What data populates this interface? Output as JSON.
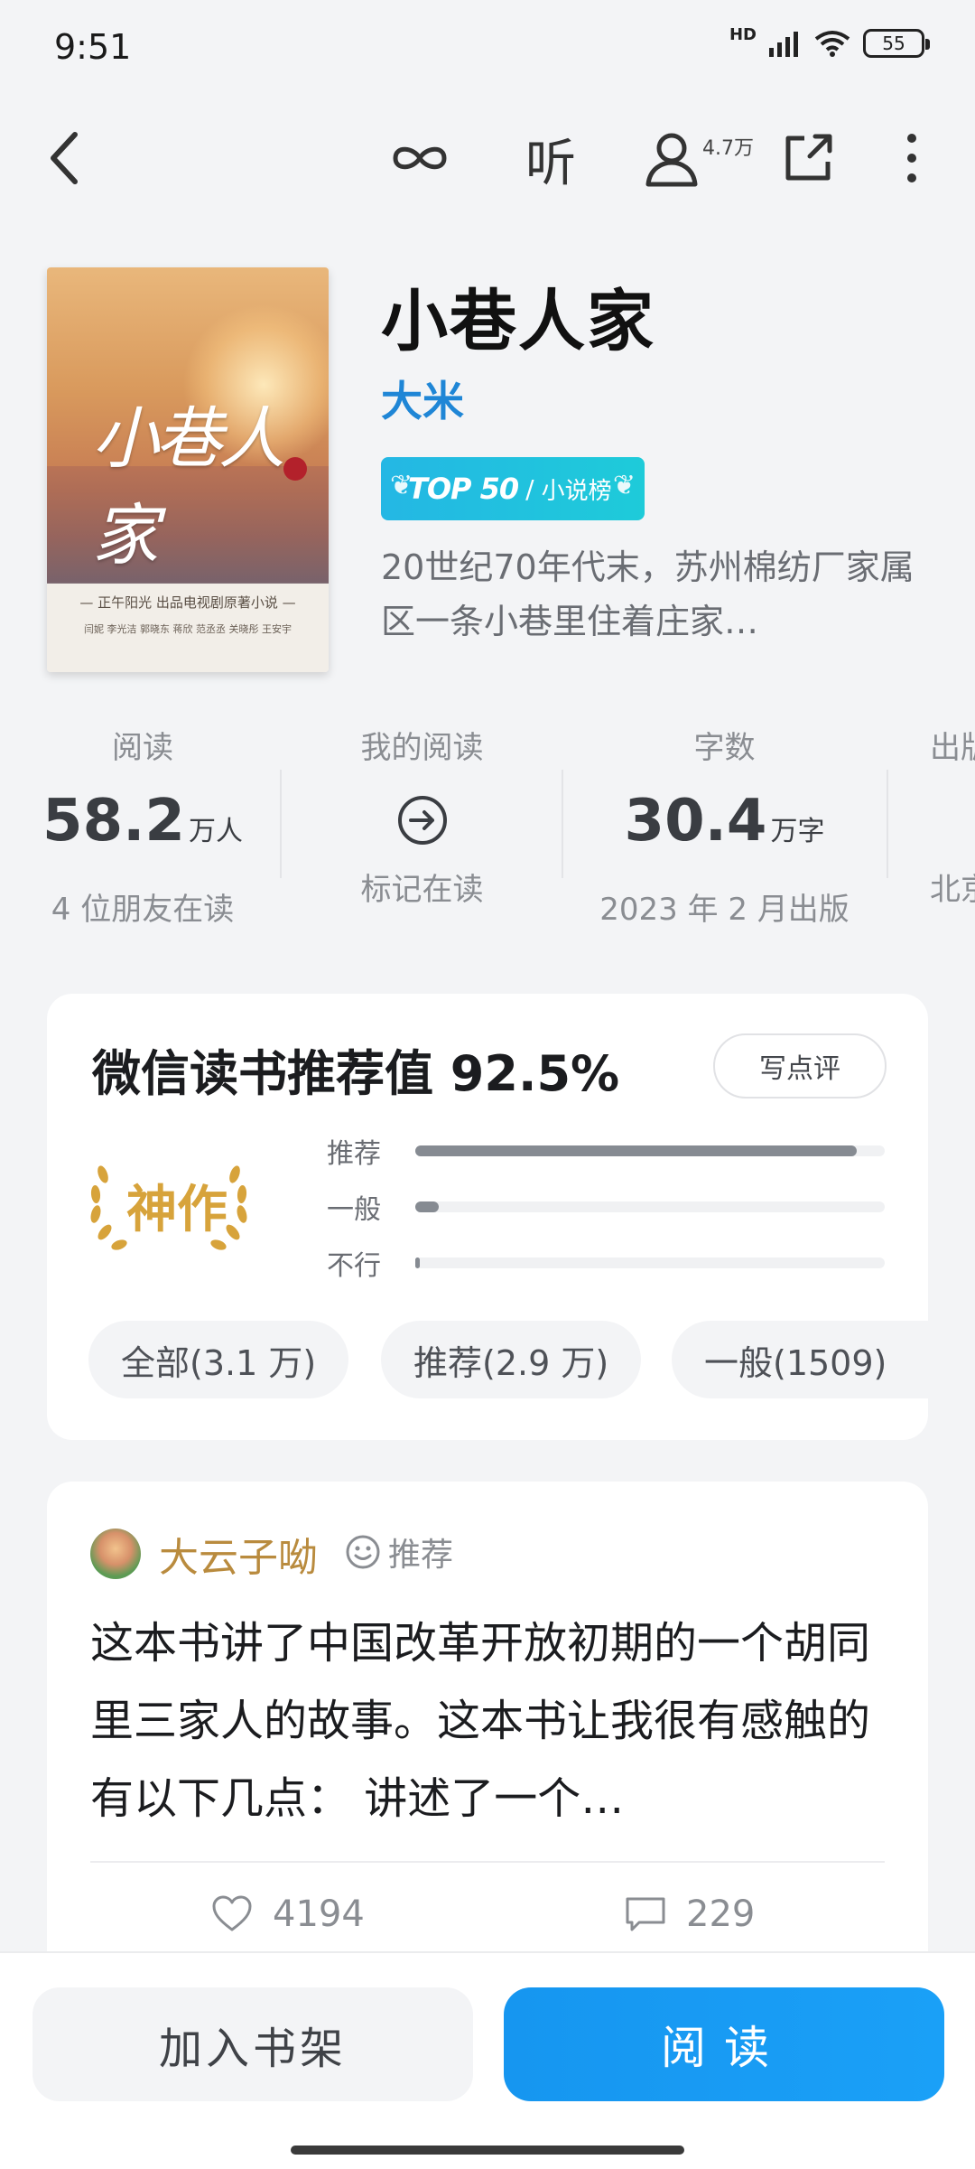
{
  "status": {
    "time": "9:51",
    "network": "HD",
    "battery": "55"
  },
  "topbar": {
    "listen_label": "听",
    "readers_count": "4.7万"
  },
  "cover": {
    "title": "小巷人家",
    "caption": "— 正午阳光 出品电视剧原著小说 —",
    "caption2": "闫妮 李光洁 郭晓东 蒋欣 范丞丞 关晓彤 王安宇"
  },
  "book": {
    "title": "小巷人家",
    "author": "大米",
    "badge_top": "TOP 50",
    "badge_sep": "/",
    "badge_category": "小说榜",
    "summary": "20世纪70年代末，苏州棉纺厂家属区一条小巷里住着庄家…"
  },
  "stats": [
    {
      "label": "阅读",
      "value": "58.2",
      "unit": "万人",
      "sub": "4 位朋友在读"
    },
    {
      "label": "我的阅读",
      "sub": "标记在读"
    },
    {
      "label": "字数",
      "value": "30.4",
      "unit": "万字",
      "sub": "2023 年 2 月出版"
    },
    {
      "label": "出版社",
      "sub": "北京"
    }
  ],
  "rating": {
    "title": "微信读书推荐值 92.5%",
    "write_button": "写点评",
    "level": "神作",
    "bars": [
      {
        "label": "推荐",
        "fraction": 0.94
      },
      {
        "label": "一般",
        "fraction": 0.05
      },
      {
        "label": "不行",
        "fraction": 0.01
      }
    ],
    "chips": [
      "全部(3.1 万)",
      "推荐(2.9 万)",
      "一般(1509)"
    ]
  },
  "review": {
    "reviewer": "大云子呦",
    "tag": "推荐",
    "text": "这本书讲了中国改革开放初期的一个胡同里三家人的故事。这本书让我很有感触的有以下几点： 讲述了一个…",
    "likes": "4194",
    "comments": "229"
  },
  "bottom": {
    "shelf_label": "加入书架",
    "read_label": "阅读"
  },
  "colors": {
    "accent": "#1a9df5",
    "author": "#1f86d6",
    "gold": "#d7a33b",
    "badge": "#24b7e4"
  }
}
